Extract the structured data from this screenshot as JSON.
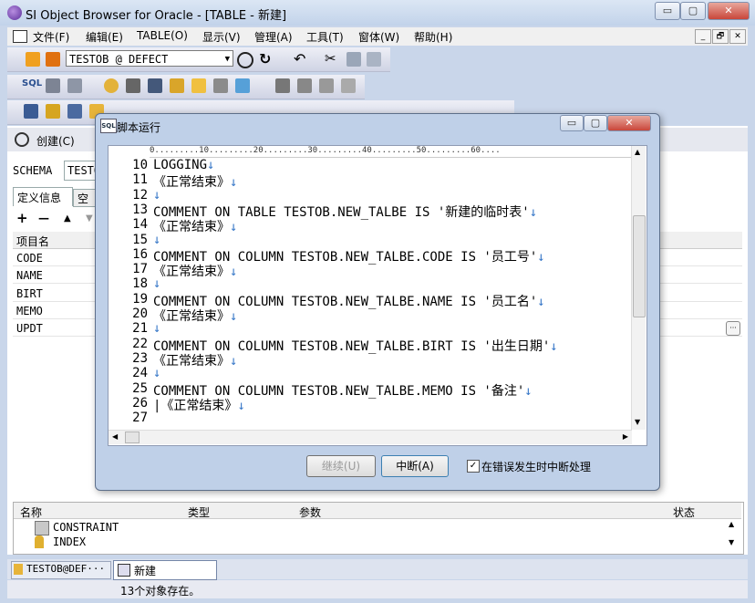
{
  "window": {
    "title": "SI Object Browser for Oracle - [TABLE - 新建]",
    "minimize": "▭",
    "maximize": "▢",
    "close": "✕"
  },
  "menu": [
    "文件(F)",
    "编辑(E)",
    "TABLE(O)",
    "显示(V)",
    "管理(A)",
    "工具(T)",
    "窗体(W)",
    "帮助(H)"
  ],
  "mdi_buttons": [
    "_",
    "🗗",
    "✕"
  ],
  "toolbar": {
    "connection": "TESTOB @ DEFECT",
    "sql_label": "SQL"
  },
  "object_panel": {
    "create_label": "创建(C)",
    "schema_label": "SCHEMA",
    "schema_value": "TESTO",
    "tabs": [
      "定义信息",
      "空"
    ],
    "item_header": "项目名",
    "items": [
      "CODE",
      "NAME",
      "BIRT",
      "MEMO",
      "UPDT"
    ],
    "add": "+",
    "remove": "—",
    "up": "▲",
    "down": "▼",
    "more": "···"
  },
  "dialog": {
    "title": "脚本运行",
    "icon": "SQL",
    "ruler": "0.........10.........20.........30.........40.........50.........60....",
    "lines": [
      {
        "num": "10",
        "code": "LOGGING",
        "nl": "↓"
      },
      {
        "num": "11",
        "code": "《正常结束》",
        "nl": "↓"
      },
      {
        "num": "12",
        "code": "",
        "nl": "↓"
      },
      {
        "num": "13",
        "code": "COMMENT ON TABLE TESTOB.NEW_TALBE IS '新建的临时表'",
        "nl": "↓"
      },
      {
        "num": "14",
        "code": "《正常结束》",
        "nl": "↓"
      },
      {
        "num": "15",
        "code": "",
        "nl": "↓"
      },
      {
        "num": "16",
        "code": "COMMENT ON COLUMN TESTOB.NEW_TALBE.CODE IS '员工号'",
        "nl": "↓"
      },
      {
        "num": "17",
        "code": "《正常结束》",
        "nl": "↓"
      },
      {
        "num": "18",
        "code": "",
        "nl": "↓"
      },
      {
        "num": "19",
        "code": "COMMENT ON COLUMN TESTOB.NEW_TALBE.NAME IS '员工名'",
        "nl": "↓"
      },
      {
        "num": "20",
        "code": "《正常结束》",
        "nl": "↓"
      },
      {
        "num": "21",
        "code": "",
        "nl": "↓"
      },
      {
        "num": "22",
        "code": "COMMENT ON COLUMN TESTOB.NEW_TALBE.BIRT IS '出生日期'",
        "nl": "↓"
      },
      {
        "num": "23",
        "code": "《正常结束》",
        "nl": "↓"
      },
      {
        "num": "24",
        "code": "",
        "nl": "↓"
      },
      {
        "num": "25",
        "code": "COMMENT ON COLUMN TESTOB.NEW_TALBE.MEMO IS '备注'",
        "nl": "↓"
      },
      {
        "num": "26",
        "code": "|《正常结束》",
        "nl": "↓"
      },
      {
        "num": "27",
        "code": "",
        "nl": ""
      }
    ],
    "continue_btn": "继续(U)",
    "abort_btn": "中断(A)",
    "checkbox_label": "在错误发生时中断处理",
    "checkbox_checked": true
  },
  "bottom_panel": {
    "headers": [
      "名称",
      "类型",
      "参数",
      "状态"
    ],
    "items": [
      "CONSTRAINT",
      "INDEX"
    ]
  },
  "tabs": [
    "TESTOB@DEF···",
    "新建"
  ],
  "status": "13个对象存在。",
  "colors": {
    "newline_marker": "#3878c8",
    "title_bg": "#c2d3ea",
    "close_button": "#c9463a"
  }
}
